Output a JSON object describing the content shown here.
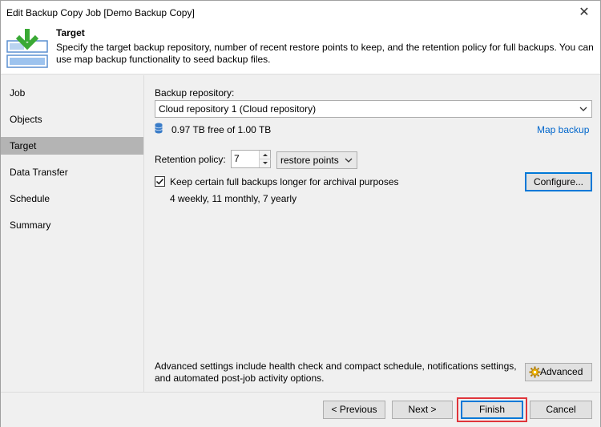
{
  "window": {
    "title": "Edit Backup Copy Job [Demo Backup Copy]",
    "close_glyph": "✕"
  },
  "header": {
    "title": "Target",
    "description": "Specify the target backup repository, number of recent restore points to keep, and the retention policy for full backups. You can use map backup functionality to seed backup files.",
    "icon": "backup-copy-download-icon"
  },
  "sidebar": {
    "items": [
      {
        "label": "Job",
        "active": false
      },
      {
        "label": "Objects",
        "active": false
      },
      {
        "label": "Target",
        "active": true
      },
      {
        "label": "Data Transfer",
        "active": false
      },
      {
        "label": "Schedule",
        "active": false
      },
      {
        "label": "Summary",
        "active": false
      }
    ]
  },
  "main": {
    "repository_label": "Backup repository:",
    "repository_value": "Cloud repository 1 (Cloud repository)",
    "space_info": "0.97 TB free of 1.00 TB",
    "map_backup_link": "Map backup",
    "retention_label": "Retention policy:",
    "retention_value": "7",
    "retention_unit": "restore points",
    "keep_full_label": "Keep certain full backups longer for archival purposes",
    "keep_full_checked": true,
    "keep_full_summary": "4 weekly, 11 monthly, 7 yearly",
    "configure_button": "Configure...",
    "advanced_desc": "Advanced settings include health check and compact schedule, notifications settings, and automated post-job activity options.",
    "advanced_button": "Advanced"
  },
  "footer": {
    "previous_button": "< Previous",
    "next_button": "Next >",
    "finish_button": "Finish",
    "cancel_button": "Cancel"
  },
  "colors": {
    "accent": "#0078d7",
    "link": "#0066cc",
    "highlight": "#e0353b",
    "active_nav": "#b4b4b4",
    "logo_green": "#3aa935"
  }
}
